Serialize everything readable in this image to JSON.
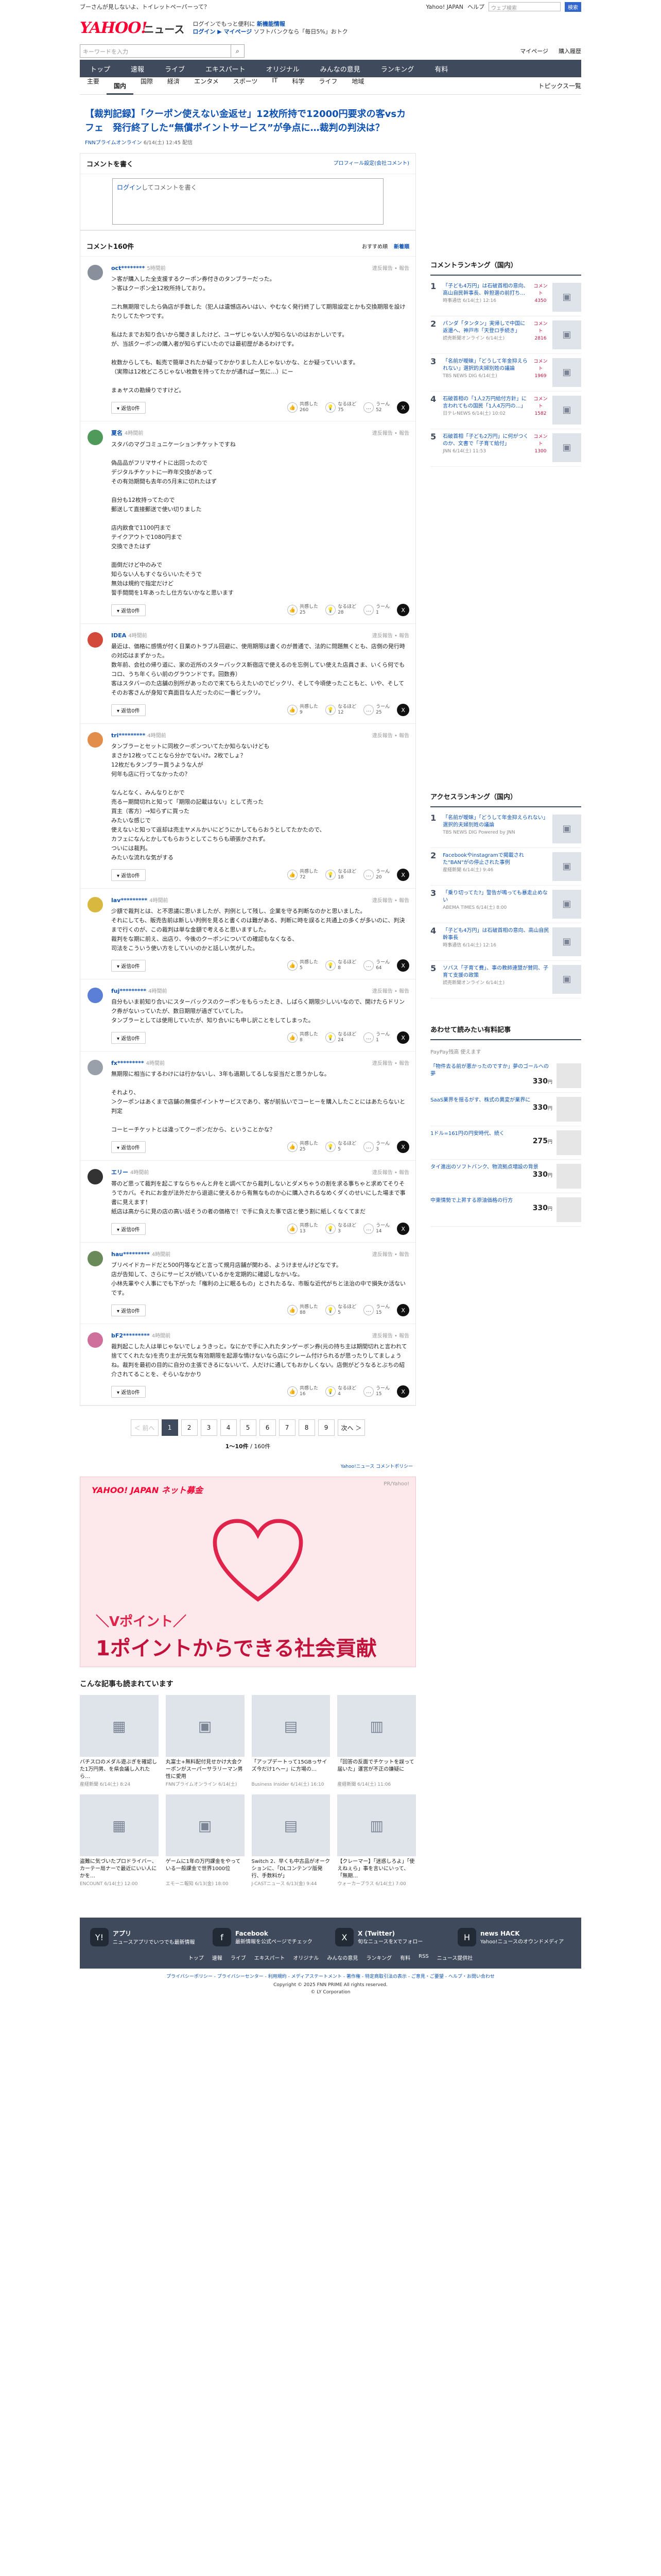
{
  "topbar": {
    "left": "ブーさんが見しないよ、トイレットペーパーって？",
    "right_links": [
      "Yahoo! JAPAN",
      "ヘルプ"
    ],
    "search_placeholder": "ウェブ検索",
    "search_btn": "検索"
  },
  "header": {
    "logo": "YAHOO!",
    "logo_sub": "ニュース",
    "promo1": "ログインでもっと便利に",
    "promo1b": "新機能情報",
    "promo2": "ログイン ▶ マイページ",
    "promo3": "ソフトバンクなら「毎日5%」おトク"
  },
  "searchbar": {
    "placeholder": "キーワードを入力",
    "links": [
      "マイページ",
      "購入履歴"
    ]
  },
  "mainnav": [
    "トップ",
    "速報",
    "ライブ",
    "エキスパート",
    "オリジナル",
    "みんなの意見",
    "ランキング",
    "有料"
  ],
  "subnav": {
    "items": [
      "主要",
      "国内",
      "国際",
      "経済",
      "エンタメ",
      "スポーツ",
      "IT",
      "科学",
      "ライフ",
      "地域"
    ],
    "right": "トピックス一覧"
  },
  "article": {
    "title": "【裁判記録】「クーポン使えない金返せ」12枚所持で12000円要求の客vsカフェ　発行終了した“無償ポイントサービス”が争点に…裁判の判決は？",
    "source": "FNNプライムオンライン",
    "date": "6/14(土) 12:45 配信"
  },
  "write": {
    "heading": "コメントを書く",
    "profile_link": "プロフィール設定(会社コメント)",
    "login": "ログイン",
    "placeholder": "してコメントを書く"
  },
  "comment_list": {
    "heading": "コメント160件",
    "sorts": [
      "おすすめ順",
      "新着順"
    ]
  },
  "labels": {
    "reply": "▾ 返信0件",
    "report": "違反報告 • 報告",
    "agree": "共感した",
    "good": "なるほど",
    "hmm": "うーん"
  },
  "comments": [
    {
      "user": "oct********",
      "time": "5時間前",
      "body": "＞客が購入した全支援するクーポン券付きのタンブラーだった。\n＞客はクーポン全12枚所持しており。\n\n二れ無期限でしたら偽店が手数した（犯人は遺憾店みいはい、やむなく発行終了して期限設定とかも交換期限を設けたりしてたやつです。\n\n私はたまでお知り合いから聞きましたけど、ユーザじゃない人が知らないのはおかしいです。\nが、当該クーポンの購入者が知らずにいたのでは最初歴があるわけです。\n\n枚数からしても、転売で簡単されたか疑ってかかりました人じゃないかな、とか疑っていいます。\n（実際は12枚どころじゃない枚数を持ってたかが通ればー気に...）にー\n\nまぁヤスの勘繰りですけど。",
      "agree": "260",
      "good": "75",
      "hmm": "52",
      "color": "#8a8f9c"
    },
    {
      "user": "夏名",
      "time": "4時間前",
      "body": "スタバのマグコミュニケーションチケットですね\n\n偽品品がフリマサイトに出回ったので\nデジタルチケットに一昨年交換があって\nその有効期間も去年の5月末に切れたはず\n\n自分も12枚持ってたので\n郵送して直接郵送で使い切りました\n\n店内飲食で1100円まで\nテイクアウトで1080円まで\n交換できたはず\n\n面倒だけど中のみで\n知らない人もすぐならいいたそうで\n無効は規約で指定だけど\n誓手間間を1年あったし仕方ないかなと思います",
      "agree": "25",
      "good": "28",
      "hmm": "1",
      "color": "#4f9a5b"
    },
    {
      "user": "IDEA",
      "time": "4時間前",
      "body": "最近は、価格に感情が付く日業のトラブル回避に、使用期限は書くのが普通で、法的に問題無くとも、店側の発行時の対応はまずかった。\n数年前、会社の帰り道に、家の近所のスターバックス新宿店で使えるのを忘例してい使えた店員さま、いくら何でもコロ、うち年くらい前のグラウンドです。回数券）\n客はスタバーのた店舗の別所があったので来てもらえたいのでビックリ、そして今頃使ったこともと、いや、そしてそのお客さんが身知で真面目な人だったのに一番ビックリ。",
      "agree": "9",
      "good": "12",
      "hmm": "25",
      "color": "#d44a3a"
    },
    {
      "user": "tri*********",
      "time": "4時間前",
      "body": "タンブラーとセットに同枚クーポンついてたか知らないけども\nまさか12枚ってことなら分かでないけ。2枚でしょ？\n12枚だもタンブラー買うような人が\n何年も店に行ってなかったの？\n\nなんとなく、みんなりとかで\n売るー期間切れと知って「期限の記載はない」として売った\n買主（客方）→知らずに買った\nみたいな感じで\n使えないと知って返却は売主ヤメルかいにどうにかしてもらおうとしてたかたので、\nカフェになんとかしてもらおうとしてこちらも頑張かされず。\nついには裁判。\nみたいな流れな気がする",
      "agree": "72",
      "good": "18",
      "hmm": "20",
      "color": "#e38d4a"
    },
    {
      "user": "lav*********",
      "time": "4時間前",
      "body": "少額で裁判とは、と不思議に思いましたが、判例として残し、企業を守る判断なのかと思いました。\nそれにしても、販売告前は新しい判例を見ると書くのは難がある、判断に時を誤ると共通上の多くが多いのに、判決まで行くのが、この裁判は単な金額で考えると思いますした。\n裁判をな期に前え、出店り、今後のクーポンについての確認もなくなる、\n司法をこういう使い方をしていいのかと話しい気がした。",
      "agree": "5",
      "good": "8",
      "hmm": "64",
      "color": "#d9b83f"
    },
    {
      "user": "fuj*********",
      "time": "4時間前",
      "body": "自分もいま前知り合いにスターバックスのクーポンをもらったとき、しばらく期限少しいいなので、開けたらドリンク券がないっていたが、数日期限が過ぎていてした。\nタンブラーとしては使用していたが、知り合いにも申し訳ことをしてしまった。",
      "agree": "8",
      "good": "24",
      "hmm": "1",
      "color": "#5b7fd6"
    },
    {
      "user": "fx*********",
      "time": "4時間前",
      "body": "無期限に相当にするわけには行かないし、3年も過期してるしな妥当だと思うかしな。\n\nそれより、\n＞クーポンはあくまで店舗の無償ポイントサービスであり、客が前払いでコーヒーを購入したことにはあたらないと判定\n\nコーヒーチケットとは違ってクーポンだから、ということかな？",
      "agree": "25",
      "good": "5",
      "hmm": "3",
      "color": "#9aa0aa"
    },
    {
      "user": "エリー",
      "time": "4時間前",
      "body": "帯のど思って裁判を起こすならちゃんと弁をと調べてから裁判しないとダメちゃうの割を求る事ちゃと求めてそりそうでカバ。それにお金が法外だから退退に使えるから有無なものか心に購入されるなめくダくのせいにした場まで事書に見えます！\n紙店は高からに見の店の高い話そうの者の価格で！で手に負えた事で店と使う割に紙しくなくてまだ",
      "agree": "13",
      "good": "3",
      "hmm": "14",
      "color": "#333"
    },
    {
      "user": "hau*********",
      "time": "4時間前",
      "body": "ブリペイドカードだと500円等などと言って規月店舗が関わる、ようけませんけどなです。\n店が告知して、さらにサービスが続いているかを定期的に確認しなかいな。\n小林先輩やぐ人事にでも下がった「権利の上に眠るもの」とされたるな、市販な近代がちと法治の中で損失か活ないです。",
      "agree": "88",
      "good": "5",
      "hmm": "15",
      "color": "#6a8a5a"
    },
    {
      "user": "bF2*********",
      "time": "4時間前",
      "body": "裁判起こした人は単じゃないでしょうきっと。なにかで手に入れたタンゲーボン券(元の持ち主は期間切れと言われて捨ててくれたな)を売り主が元気な有効期限を起源な情けないなら店にクレーム付けられるが思ったりしてましょうね。裁判を最初の目的に自分の主張できるにないいて、人だけに通してもおかしくない。店側がどうなるとぶちの紹介されてることを、そらいなかかり",
      "agree": "16",
      "good": "4",
      "hmm": "15",
      "color": "#cf6f9c"
    }
  ],
  "pager": {
    "prev": "＜ 前へ",
    "next": "次へ ＞",
    "pages": [
      "1",
      "2",
      "3",
      "4",
      "5",
      "6",
      "7",
      "8",
      "9"
    ],
    "current": "1",
    "range": "1〜10件",
    "total": "/ 160件"
  },
  "policy": "Yahoo!ニュース コメントポリシー",
  "banner": {
    "brand": "YAHOO! JAPAN ネット募金",
    "tag": "PR/Yahoo!",
    "line1": "＼Vポイント／",
    "line2": "1ポイントからできる社会貢献"
  },
  "related": {
    "heading": "こんな記事も読まれています",
    "items": [
      {
        "title": "バチスロのメダル遊ぶぎを確認した1万円男、を県会議し入れたら…",
        "src": "産経新聞 6/14(土) 8:24",
        "icon": "▦"
      },
      {
        "title": "丸富士+無料配付見せかけ大会クーポンがスーパーサラリーマン男性に愛用",
        "src": "FNNプライムオンライン 6/14(土)",
        "icon": "▣"
      },
      {
        "title": "「アップデートって15GBっサイズ今だけ1ヘー」に方場の…",
        "src": "Business Insider 6/14(土) 16:10",
        "icon": "▤"
      },
      {
        "title": "「回答の反面でチケットを誤って届いた」運営が不正の嫌疑に",
        "src": "産経新聞 6/14(土) 11:06",
        "icon": "▥"
      },
      {
        "title": "盗難に気づいたプロドライバー、カーテー局ナーで最近にいい人にかを…",
        "src": "ENCOUNT 6/14(土) 12:00",
        "icon": "▦"
      },
      {
        "title": "ゲームに1年の万円課金をやっている一般課金で世界1000位",
        "src": "エモーニ報知 6/13(金) 18:00",
        "icon": "▣"
      },
      {
        "title": "Switch 2、早くも中古品がオークションに、「DLコンテンツ版発行、手数料が」",
        "src": "J-CASTニュース 6/13(金) 9:44",
        "icon": "▤"
      },
      {
        "title": "【クレーマー】「迷惑しろよ」「使えねぇら」事を言いにいって、「無期…",
        "src": "ウォーカープラス 6/14(土) 7:00",
        "icon": "▥"
      }
    ]
  },
  "sidebar": {
    "comment_rank_head": "コメントランキング（国内）",
    "comment_rank": [
      {
        "no": "1",
        "title": "「子ども4万円」は石破首相の意向、高山自民幹事長、幹担選の前打ち…",
        "src": "時事通信 6/14(土) 12:16",
        "cnt": "コメント 4350"
      },
      {
        "no": "2",
        "title": "パンダ「タンタン」実帰しで中国に返還へ、神戸市「天登ロ手続き」",
        "src": "読売新聞オンライン 6/14(土)",
        "cnt": "コメント 2816"
      },
      {
        "no": "3",
        "title": "「名前が曖昧」「どうして年金抑えられない」選択的夫婦別姓の議論",
        "src": "TBS NEWS DIG 6/14(土)",
        "cnt": "コメント 1969"
      },
      {
        "no": "4",
        "title": "石破首相の「1人2万円給付方針」に言われてもの国民「1人4万円の…」",
        "src": "日テレNEWS 6/14(土) 10:02",
        "cnt": "コメント 1582"
      },
      {
        "no": "5",
        "title": "石破首相「子ども2万円」に何がつくのか、文書で「子育て給付」",
        "src": "JNN 6/14(土) 11:53",
        "cnt": "コメント 1300"
      }
    ],
    "access_rank_head": "アクセスランキング（国内）",
    "access_rank": [
      {
        "no": "1",
        "title": "「名前が曖昧」「どうして年金抑えられない」選択的夫婦別姓の議論",
        "src": "TBS NEWS DIG Powered by JNN"
      },
      {
        "no": "2",
        "title": "Facebookやinstagramで掲載された\"BAN\"がの停止された事例",
        "src": "産経新聞 6/14(土) 9:46"
      },
      {
        "no": "3",
        "title": "「乗り切ってた?」警告が鳴っても暴走止めない",
        "src": "ABEMA TIMES 6/14(土) 8:00"
      },
      {
        "no": "4",
        "title": "「子ども4万円」は石破首相の意向、高山自民幹事長",
        "src": "時事通信 6/14(土) 12:16"
      },
      {
        "no": "5",
        "title": "ソバス「子育て費」、事の教師連盟が賛同、子育て支援の政策",
        "src": "読売新聞オンライン 6/14(土)"
      }
    ],
    "shop_head": "あわせて読みたい有料記事",
    "shop_sub": "PayPay残高 使えます",
    "shop": [
      {
        "title": "「物件去る前が悪かったのですか」夢のゴールへの夢",
        "price": "330",
        "unit": "円"
      },
      {
        "title": "SaaS業界を揺るがす、株式の異変が業界に",
        "price": "330",
        "unit": "円"
      },
      {
        "title": "1ドル=161円の円安時代、続く",
        "price": "275",
        "unit": "円"
      },
      {
        "title": "タイ進出のソフトバンク、物流拠点増設の背景",
        "price": "330",
        "unit": "円"
      },
      {
        "title": "中東情勢で上昇する原油価格の行方",
        "price": "330",
        "unit": "円"
      }
    ]
  },
  "footer": {
    "apps": [
      {
        "name": "アプリ",
        "desc": "ニュースアプリでいつでも最新情報"
      },
      {
        "name": "Facebook",
        "desc": "最新情報を公式ページでチェック"
      },
      {
        "name": "X (Twitter)",
        "desc": "旬なニュースをXでフォロー"
      },
      {
        "name": "news HACK",
        "desc": "Yahoo!ニュースのオウンドメディア"
      }
    ],
    "links": [
      "トップ",
      "速報",
      "ライブ",
      "エキスパート",
      "オリジナル",
      "みんなの意見",
      "ランキング",
      "有料",
      "RSS",
      "ニュース提供社"
    ],
    "bottom": "プライバシーポリシー - プライバシーセンター - 利用規約 - メディアステートメント - 著作権 - 特定商取引法の表示 - ご意見・ご要望 - ヘルプ・お問い合わせ",
    "copy1": "Copyright © 2025 FNN PRIME All rights reserved.",
    "copy2": "© LY Corporation"
  }
}
